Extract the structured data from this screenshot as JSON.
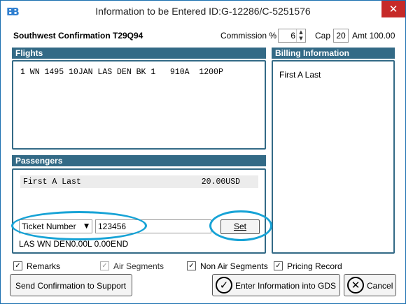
{
  "window": {
    "app_icon": "BB",
    "title": "Information to be Entered   ID:G-12286/C-5251576",
    "close_glyph": "✕"
  },
  "header": {
    "confirmation": "Southwest Confirmation T29Q94",
    "commission_label": "Commission %",
    "commission_value": "6",
    "cap_label": "Cap",
    "cap_value": "20",
    "amt_label": "Amt 100.00"
  },
  "flights": {
    "title": "Flights",
    "lines": [
      "1 WN 1495 10JAN LAS DEN BK 1   910A  1200P"
    ]
  },
  "billing": {
    "title": "Billing Information",
    "name": "First A Last"
  },
  "passengers": {
    "title": "Passengers",
    "rows": [
      {
        "name": "First A Last",
        "amount": "20.00USD"
      }
    ],
    "field_select": "Ticket Number",
    "field_value": "123456",
    "set_label": "Set",
    "fare_line": "LAS WN DEN0.00L 0.00END"
  },
  "options": [
    {
      "label": "Remarks",
      "checked": true,
      "disabled": false
    },
    {
      "label": "Air Segments",
      "checked": true,
      "disabled": true
    },
    {
      "label": "Non Air Segments",
      "checked": true,
      "disabled": false
    },
    {
      "label": "Pricing Record",
      "checked": true,
      "disabled": false
    }
  ],
  "buttons": {
    "support": "Send Confirmation to Support",
    "enter": "Enter Information into GDS",
    "cancel": "Cancel"
  },
  "colors": {
    "panel_header": "#336a86",
    "callout": "#17a3d6",
    "close": "#c62a28"
  }
}
